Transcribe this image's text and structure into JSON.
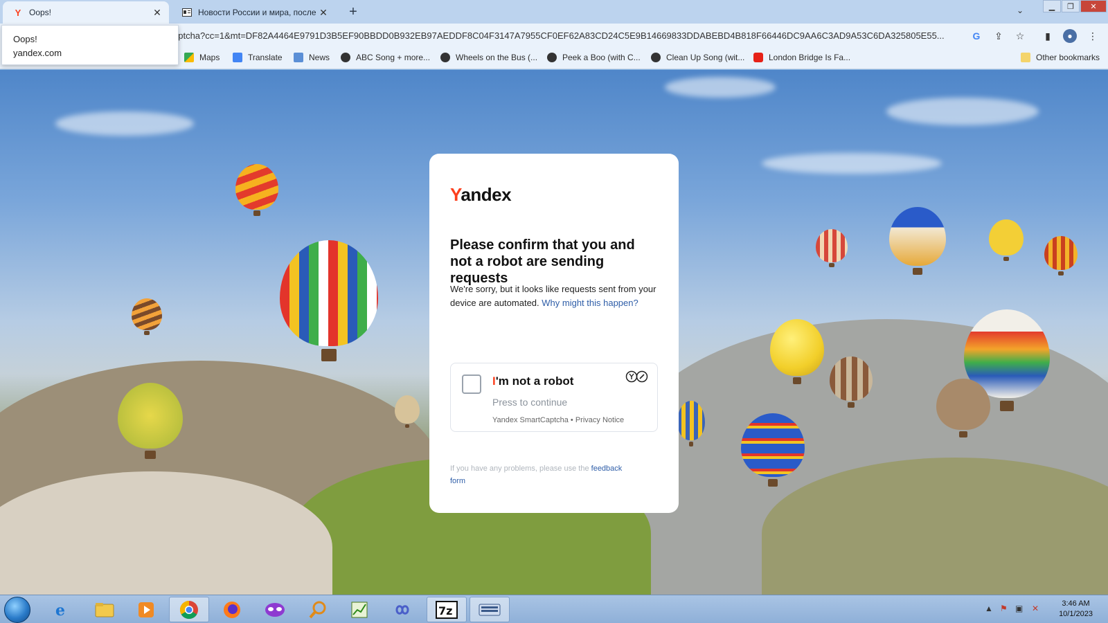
{
  "browser": {
    "tabs": [
      {
        "title": "Oops!",
        "favicon": "yandex-icon",
        "active": true
      },
      {
        "title": "Новости России и мира, после",
        "favicon": "news-icon",
        "active": false
      }
    ],
    "tooltip": {
      "title": "Oops!",
      "host": "yandex.com"
    },
    "url": "aptcha?cc=1&mt=DF82A4464E9791D3B5EF90BBDD0B932EB97AEDDF8C04F3147A7955CF0EF62A83CD24C5E9B14669833DDABEBD4B818F66446DC9AA6C3AD9A53C6DA325805E55...",
    "bookmarks": [
      {
        "label": "Maps",
        "icon": "maps-icon"
      },
      {
        "label": "Translate",
        "icon": "translate-icon"
      },
      {
        "label": "News",
        "icon": "news-icon"
      },
      {
        "label": "ABC Song + more...",
        "icon": "globe-icon"
      },
      {
        "label": "Wheels on the Bus (...",
        "icon": "globe-icon"
      },
      {
        "label": "Peek a Boo (with C...",
        "icon": "globe-icon"
      },
      {
        "label": "Clean Up Song (wit...",
        "icon": "globe-icon"
      },
      {
        "label": "London Bridge Is Fa...",
        "icon": "youtube-icon"
      }
    ],
    "other_bookmarks": "Other bookmarks"
  },
  "captcha": {
    "logo_first": "Y",
    "logo_rest": "andex",
    "heading": "Please confirm that you and not a robot are sending requests",
    "desc": "We're sorry, but it looks like requests sent from your device are automated.",
    "why_link": "Why might this happen?",
    "robot_first": "I",
    "robot_rest": "'m not a robot",
    "robot_sub": "Press to continue",
    "foot_brand": "Yandex SmartCaptcha",
    "foot_sep": " • ",
    "foot_privacy": "Privacy Notice",
    "feedback_text": "If you have any problems, please use the",
    "feedback_link_1": "feedback",
    "feedback_link_2": "form"
  },
  "taskbar": {
    "time": "3:46 AM",
    "date": "10/1/2023",
    "apps": [
      "ie-icon",
      "explorer-icon",
      "media-player-icon",
      "chrome-icon",
      "firefox-icon",
      "mask-app-icon",
      "search-app-icon",
      "chart-app-icon",
      "infinity-app-icon",
      "7zip-icon",
      "keyboard-app-icon"
    ]
  },
  "colors": {
    "yandex_red": "#fc3f1d",
    "link_blue": "#2f5ea8"
  }
}
